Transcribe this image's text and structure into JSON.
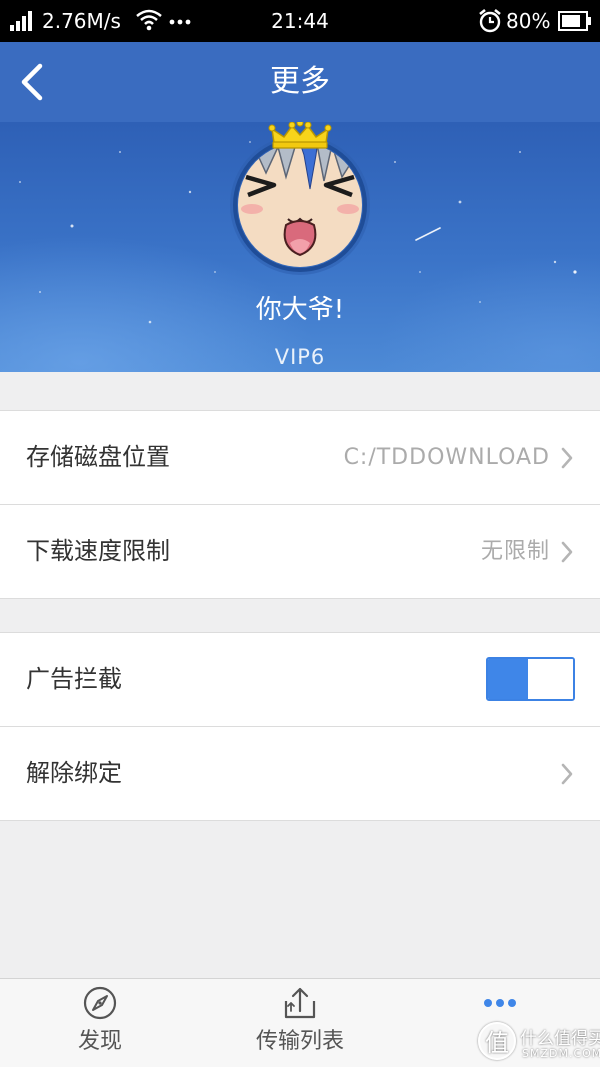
{
  "status_bar": {
    "speed": "2.76M/s",
    "time": "21:44",
    "battery": "80%",
    "icons": [
      "signal-icon",
      "wifi-icon",
      "notification-dots-icon",
      "alarm-icon",
      "battery-icon"
    ]
  },
  "header": {
    "title": "更多",
    "back_icon": "back-chevron-icon"
  },
  "profile": {
    "name": "你大爷!",
    "level": "VIP6",
    "avatar_badge_icon": "crown-icon"
  },
  "settings": {
    "storage_location": {
      "label": "存储磁盘位置",
      "value": "C:/TDDOWNLOAD"
    },
    "speed_limit": {
      "label": "下载速度限制",
      "value": "无限制"
    },
    "ad_block": {
      "label": "广告拦截",
      "enabled": true
    },
    "unbind": {
      "label": "解除绑定"
    }
  },
  "tabbar": {
    "tabs": [
      {
        "label": "发现",
        "icon": "compass-icon",
        "active": false
      },
      {
        "label": "传输列表",
        "icon": "upload-icon",
        "active": false
      },
      {
        "icon": "more-dots-icon",
        "active": true
      }
    ]
  },
  "watermark": {
    "logo": "值",
    "text": "什么值得买",
    "domain": "SMZDM.COM"
  },
  "colors": {
    "header": "#3a6cc0",
    "accent": "#3f86e8",
    "background": "#efeff0",
    "status_bar": "#000000"
  }
}
